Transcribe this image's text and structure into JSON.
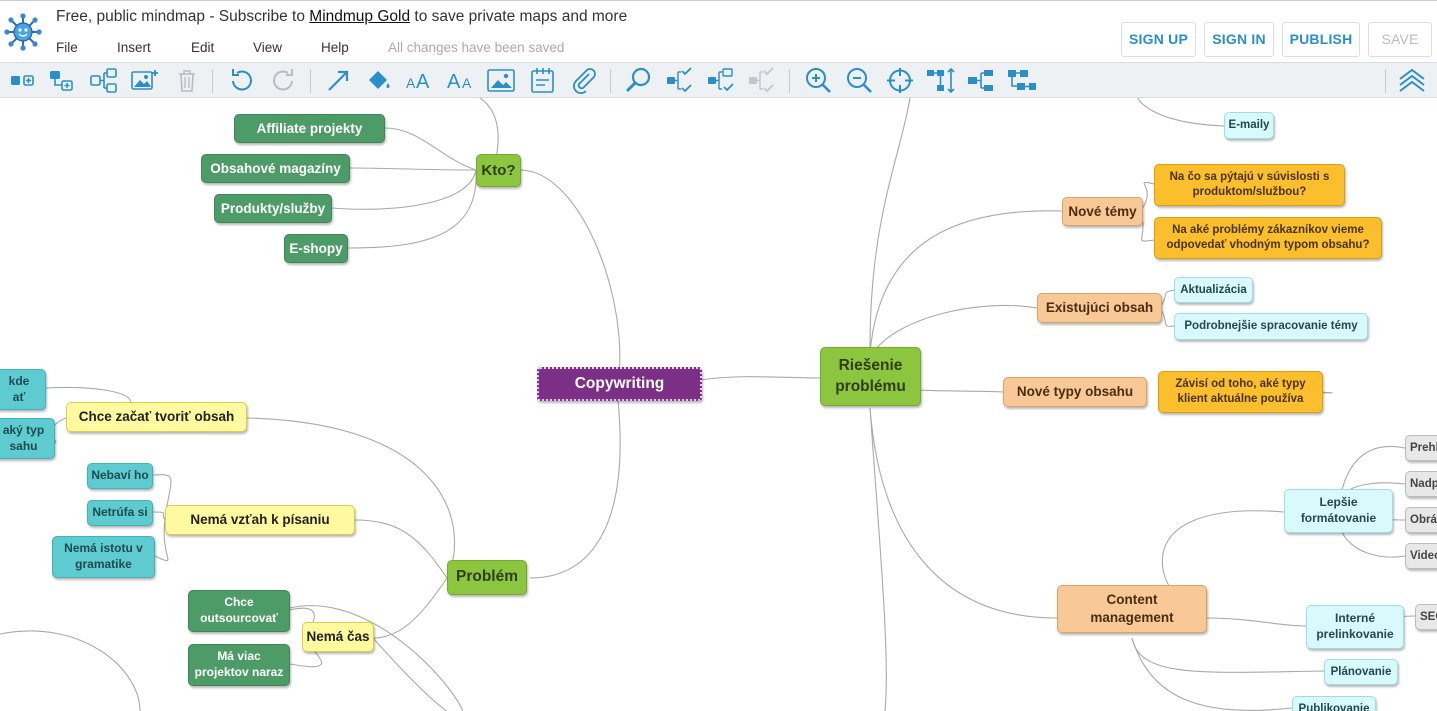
{
  "header": {
    "title_prefix": "Free, public mindmap - Subscribe to ",
    "title_link": "Mindmup Gold",
    "title_suffix": " to save private maps and more",
    "menu": [
      "File",
      "Insert",
      "Edit",
      "View",
      "Help"
    ],
    "status": "All changes have been saved",
    "buttons": {
      "signup": "SIGN UP",
      "signin": "SIGN IN",
      "publish": "PUBLISH",
      "save": "SAVE"
    }
  },
  "toolbar": {
    "icons": [
      "add-child-icon",
      "add-sibling-icon",
      "insert-parent-icon",
      "add-image-icon",
      "delete-icon",
      "undo-icon",
      "redo-icon",
      "add-link-icon",
      "fill-color-icon",
      "increase-font-icon",
      "decrease-font-icon",
      "node-image-icon",
      "note-icon",
      "attachment-icon",
      "search-icon",
      "toggle-collapse-icon",
      "progress-icon",
      "clear-progress-icon",
      "zoom-in-icon",
      "zoom-out-icon",
      "reset-view-icon",
      "layout-top-down-icon",
      "layout-standard-icon",
      "layout-org-icon",
      "collapse-toolbar-icon"
    ]
  },
  "colors": {
    "accent": "#2a8fc9",
    "root": "#7b2f85",
    "lime": "#8cc63f",
    "green": "#4d9c68",
    "teal": "#5dcbd0",
    "yellow": "#fff9a0",
    "peach": "#f8c996",
    "orange": "#fbbf2e",
    "light_blue": "#d8fafd",
    "gray": "#e8e8e8"
  },
  "mindmap": {
    "root": "Copywriting",
    "kto": "Kto?",
    "kto_children": [
      "Affiliate projekty",
      "Obsahové magazíny",
      "Produkty/služby",
      "E-shopy"
    ],
    "riesenie": "Riešenie\nproblému",
    "nove_temy": "Nové témy",
    "nove_temy_children": [
      "Na čo sa pýtajú v súvislosti s\nproduktom/službou?",
      "Na aké problémy zákazníkov vieme\nodpovedať vhodným typom obsahu?"
    ],
    "existujuci": "Existujúci obsah",
    "existujuci_children": [
      "Aktualizácia",
      "Podrobnejšie spracovanie témy"
    ],
    "nove_typy": "Nové typy obsahu",
    "nove_typy_child": "Závisí od toho, aké typy\nklient aktuálne používa",
    "content_mgmt": "Content\nmanagement",
    "lepsie": "Lepšie\nformátovanie",
    "lepsie_children": [
      "Prehl",
      "Nadp",
      "Obrá",
      "Video"
    ],
    "interne": "Interné\nprelinkovanie",
    "seo": "SEO",
    "planovanie": "Plánovanie",
    "publikovanie": "Publikovanie",
    "emaily": "E-maily",
    "problem": "Problém",
    "chce": "Chce začať tvoriť obsah",
    "chce_children": [
      "kde\nať",
      "aký typ\nsahu"
    ],
    "nema_vztah": "Nemá vzťah k písaniu",
    "nema_vztah_children": [
      "Nebaví ho",
      "Netrúfa si",
      "Nemá istotu v\ngramatike"
    ],
    "nema_cas": "Nemá čas",
    "nema_cas_children": [
      "Chce\noutsourcovať",
      "Má viac\nprojektov naraz"
    ]
  }
}
